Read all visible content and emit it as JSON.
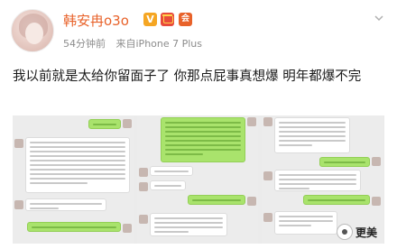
{
  "post": {
    "author": "韩安冉o3o",
    "time": "54分钟前",
    "source": "来自iPhone 7 Plus",
    "text": "我以前就是太给你留面子了 你那点屁事真想爆 明年都爆不完",
    "badges": [
      "v-badge-icon",
      "red-envelope-icon",
      "vip-icon"
    ]
  },
  "image": {
    "watermark": "更美"
  },
  "colors": {
    "author": "#e8622a",
    "meta": "#8c8c8c",
    "bubble_green": "#a9e36c"
  }
}
